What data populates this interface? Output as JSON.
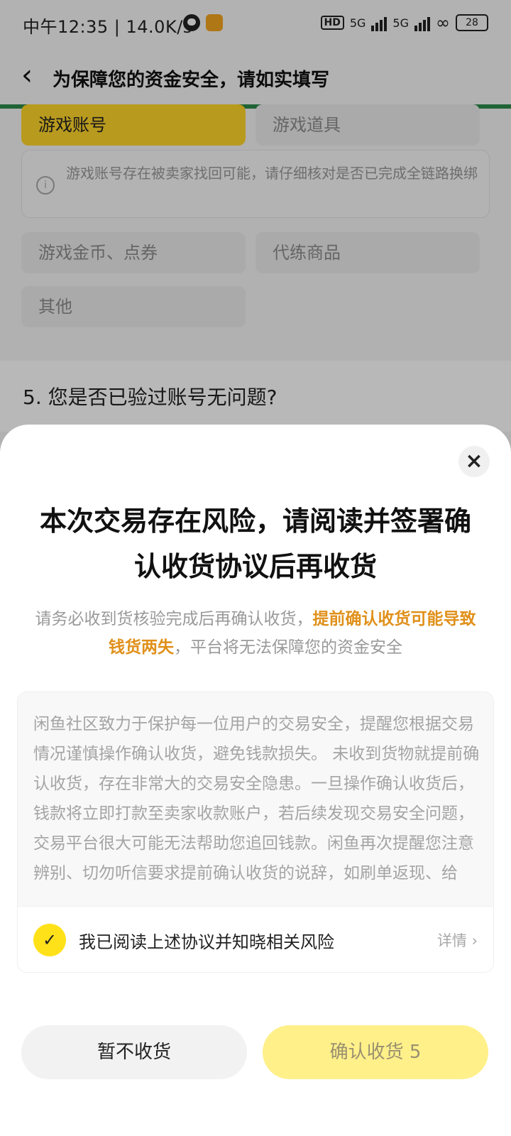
{
  "status_bar": {
    "time": "中午12:35",
    "speed": "14.0K/s",
    "hd": "HD",
    "net1": "5G",
    "net2": "5G",
    "battery": "28"
  },
  "nav": {
    "title": "为保障您的资金安全，请如实填写"
  },
  "form": {
    "options": [
      "游戏账号",
      "游戏道具",
      "游戏金币、点券",
      "代练商品",
      "其他"
    ],
    "selected": "游戏账号",
    "hint": "游戏账号存在被卖家找回可能，请仔细核对是否已完成全链路换绑",
    "question5": "5. 您是否已验过账号无问题?"
  },
  "sheet": {
    "title": "本次交易存在风险，请阅读并签署确认收货协议后再收货",
    "sub_before": "请务必收到货核验完成后再确认收货，",
    "sub_highlight": "提前确认收货可能导致钱货两失",
    "sub_after": "，平台将无法保障您的资金安全",
    "agreement": "闲鱼社区致力于保护每一位用户的交易安全，提醒您根据交易情况谨慎操作确认收货，避免钱款损失。 未收到货物就提前确认收货，存在非常大的交易安全隐患。一旦操作确认收货后，钱款将立即打款至卖家收款账户，若后续发现交易安全问题，交易平台很大可能无法帮助您追回钱款。闲鱼再次提醒您注意辨别、切勿听信要求提前确认收货的说辞，如刷单返现、给",
    "checkbox_label": "我已阅读上述协议并知晓相关风险",
    "detail_label": "详情",
    "checked": true
  },
  "buttons": {
    "cancel": "暂不收货",
    "confirm": "确认收货 5"
  },
  "colors": {
    "accent_yellow": "#ffe11a",
    "warning_orange": "#e0901a",
    "confirm_disabled": "#fff08a"
  }
}
